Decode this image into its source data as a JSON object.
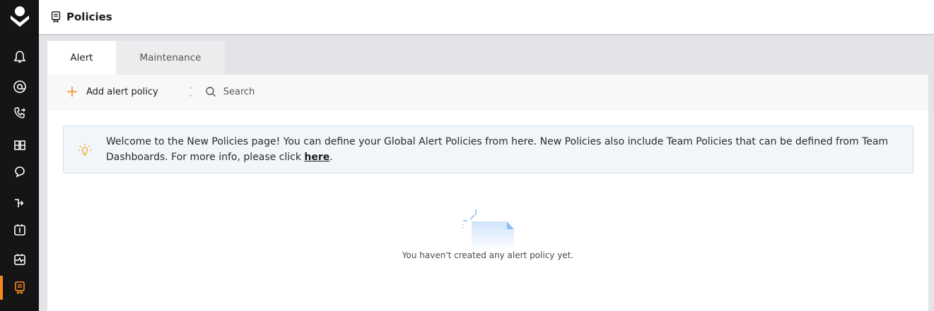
{
  "sidebar": {
    "logo_icon": "brand-logo-icon",
    "items": [
      {
        "icon": "bell-icon",
        "active": false
      },
      {
        "icon": "at-sign-icon",
        "active": false
      },
      {
        "icon": "phone-forward-icon",
        "active": false
      },
      {
        "icon": "services-icon",
        "active": false
      },
      {
        "icon": "chat-icon",
        "active": false
      },
      {
        "icon": "routing-icon",
        "active": false
      },
      {
        "icon": "calendar-icon",
        "active": false
      },
      {
        "icon": "heartbeat-icon",
        "active": false
      },
      {
        "icon": "policies-icon",
        "active": true
      }
    ],
    "accent_color": "#f68a1f"
  },
  "header": {
    "icon": "policies-icon",
    "title": "Policies"
  },
  "tabs": [
    {
      "label": "Alert",
      "active": true
    },
    {
      "label": "Maintenance",
      "active": false
    }
  ],
  "toolbar": {
    "add_label": "Add alert policy",
    "search_placeholder": "Search"
  },
  "banner": {
    "icon": "lightbulb-icon",
    "message": "Welcome to the New Policies page! You can define your Global Alert Policies from here. New Policies also include Team Policies that can be defined from Team Dashboards. For more info, please click ",
    "link_label": "here",
    "suffix": "."
  },
  "empty_state": {
    "icon": "empty-document-icon",
    "message": "You haven't created any alert policy yet."
  }
}
